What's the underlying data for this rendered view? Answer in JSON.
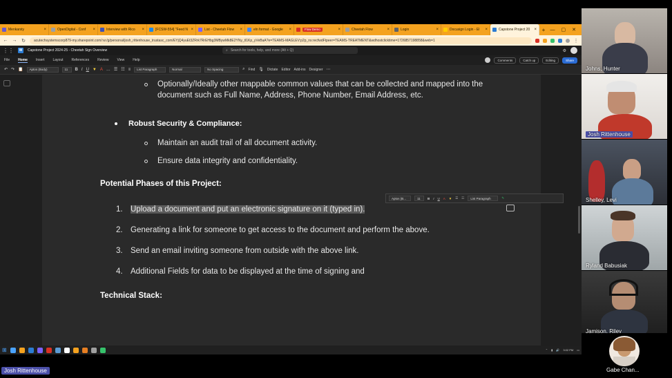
{
  "browser": {
    "tabs": [
      {
        "title": "Menkarsty",
        "color": "#6a5acd"
      },
      {
        "title": "OpenDigital - Conf",
        "color": "#9aa0a6"
      },
      {
        "title": "Interview with Rico",
        "color": "#3f51b5"
      },
      {
        "title": "[FCSW-554] \"Feed N",
        "color": "#1e88e5"
      },
      {
        "title": "List - Cheetah Flow",
        "color": "#7b61ff"
      },
      {
        "title": "eln format - Google",
        "color": "#4285f4"
      },
      {
        "title": "Flow Demo",
        "color": "#d93025",
        "badge": true
      },
      {
        "title": "Cheetah Flow",
        "color": "#9e9e9e"
      },
      {
        "title": "Login",
        "color": "#5f6368"
      },
      {
        "title": "Docusign Login - El",
        "color": "#ffcc00"
      },
      {
        "title": "Capstone Project 20",
        "color": "#2b7cd3",
        "active": true
      }
    ],
    "url": "acutechsystemscorp879-my.sharepoint.com/:w:/g/personal/josh_rittenhouse_trustasc_com/EYjQ4yuEt3ZRrk7RrEHbg3MBywMk8E2YNy_tl1Kp_yVeBaA?e=TEAMS-MAGLEV:p2p_ns:recfwdFtpeer=TEAMS-TREATMENT&wdhostclicktime=1726857198858&web=1"
  },
  "word": {
    "doc_title": "Capstone Project 2024-25 - Cheetah Sign Overview",
    "search_placeholder": "Search for tools, help, and more (Alt + Q)",
    "menus": [
      "File",
      "Home",
      "Insert",
      "Layout",
      "References",
      "Review",
      "View",
      "Help"
    ],
    "active_menu": "Home",
    "right_buttons": {
      "comments": "Comments",
      "catchup": "Catch up",
      "editing": "Editing",
      "share": "Share"
    },
    "ribbon": {
      "font": "Aptos (Body)",
      "size": "11",
      "styles": [
        "List Paragraph",
        "Normal",
        "No Spacing"
      ],
      "find": "Find",
      "dictate": "Dictate",
      "editor": "Editor",
      "addins": "Add-ins",
      "designer": "Designer"
    },
    "content": {
      "sub_optional": "Optionally/Ideally other mappable common values that can be collected and mapped into the document such as Full Name, Address, Phone Number, Email Address, etc.",
      "bullet_security": "Robust Security & Compliance:",
      "sub_audit": "Maintain an audit trail of all document activity.",
      "sub_integrity": "Ensure data integrity and confidentiality.",
      "heading_phases": "Potential Phases of this Project:",
      "phases": [
        {
          "num": "1.",
          "text": "Upload a document and put an electronic signature on it (typed in)."
        },
        {
          "num": "2.",
          "text": "Generating a link for someone to get access to the document and perform the above."
        },
        {
          "num": "3.",
          "text": "Send an email inviting someone from outside with the above link."
        },
        {
          "num": "4.",
          "text": "Additional Fields for data to be displayed at the time of signing and"
        }
      ],
      "heading_stack": "Technical Stack:"
    },
    "minitoolbar": {
      "font": "Aptos (B...",
      "size": "11",
      "style": "List Paragraph"
    },
    "status": {
      "page": "Page 1 of 2",
      "words": "13 of 321 words",
      "lang": "English (U.S.)",
      "predictions": "Text Predictions: On",
      "suggestions": "Editor Suggestions: Showing",
      "zoom": "100%",
      "fit": "Fit",
      "feedback": "Give Feedback to Microsoft"
    }
  },
  "taskbar": {
    "time": "3:02 PM",
    "icon_colors": [
      "#4aa3ff",
      "#f4a21f",
      "#2b7cd3",
      "#7b61ff",
      "#d93025",
      "#5b9bd5",
      "#ffffff",
      "#f4a21f",
      "#e67e22",
      "#a0a0a0",
      "#36c26b"
    ]
  },
  "participants": [
    {
      "name": "Johns, Hunter",
      "tag": false
    },
    {
      "name": "Josh Rittenhouse",
      "tag": true
    },
    {
      "name": "Shelley, Levi",
      "tag": false
    },
    {
      "name": "Ryland Babusiak",
      "tag": false
    },
    {
      "name": "Jamison, Riley",
      "tag": false
    },
    {
      "name": "Gabe Chan...",
      "tag": false
    }
  ],
  "self_label": "Josh Rittenhouse"
}
